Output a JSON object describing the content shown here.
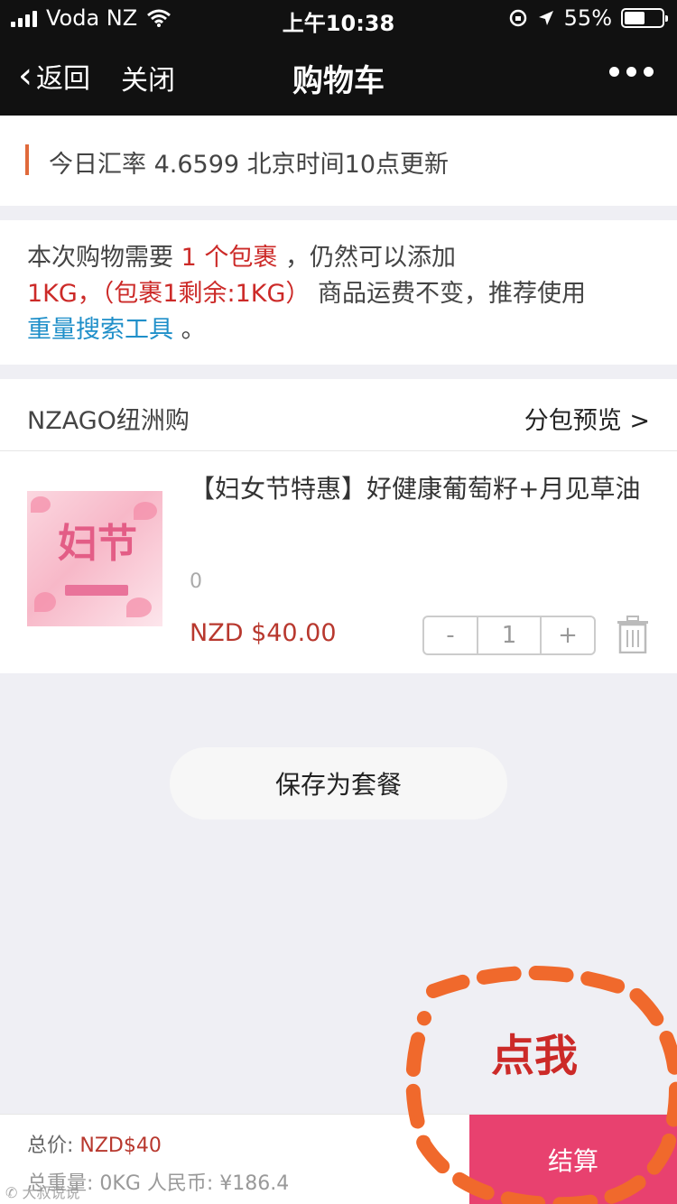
{
  "status_bar": {
    "carrier": "Voda NZ",
    "time": "上午10:38",
    "battery": "55%",
    "battery_level": 0.55
  },
  "nav": {
    "back_label": "返回",
    "close_label": "关闭",
    "title": "购物车"
  },
  "exchange": {
    "text": "今日汇率 4.6599 北京时间10点更新"
  },
  "notice": {
    "prefix": "本次购物需要 ",
    "packages": "1 个包裹",
    "mid": " ，仍然可以添加",
    "remaining": "1KG，（包裹1剩余:1KG）",
    "suffix": " 商品运费不变，推荐使用",
    "tool_link": "重量搜索工具",
    "end": " 。"
  },
  "shop": {
    "name": "NZAGO纽洲购",
    "preview_label": "分包预览 >"
  },
  "product": {
    "name": "【妇女节特惠】好健康葡萄籽+月见草油",
    "spec": "0",
    "price": "NZD $40.00",
    "quantity": "1",
    "minus_label": "-",
    "plus_label": "+"
  },
  "save_button": "保存为套餐",
  "annotation": {
    "text": "点我",
    "color": "#f0692c"
  },
  "footer": {
    "total_label": "总价: ",
    "total_value": "NZD$40",
    "weight": "总重量: 0KG 人民币: ¥186.4",
    "checkout_label": "结算"
  },
  "colors": {
    "accent_red": "#cc2a28",
    "link_blue": "#1f8fc9",
    "checkout_pink": "#e8416f"
  }
}
